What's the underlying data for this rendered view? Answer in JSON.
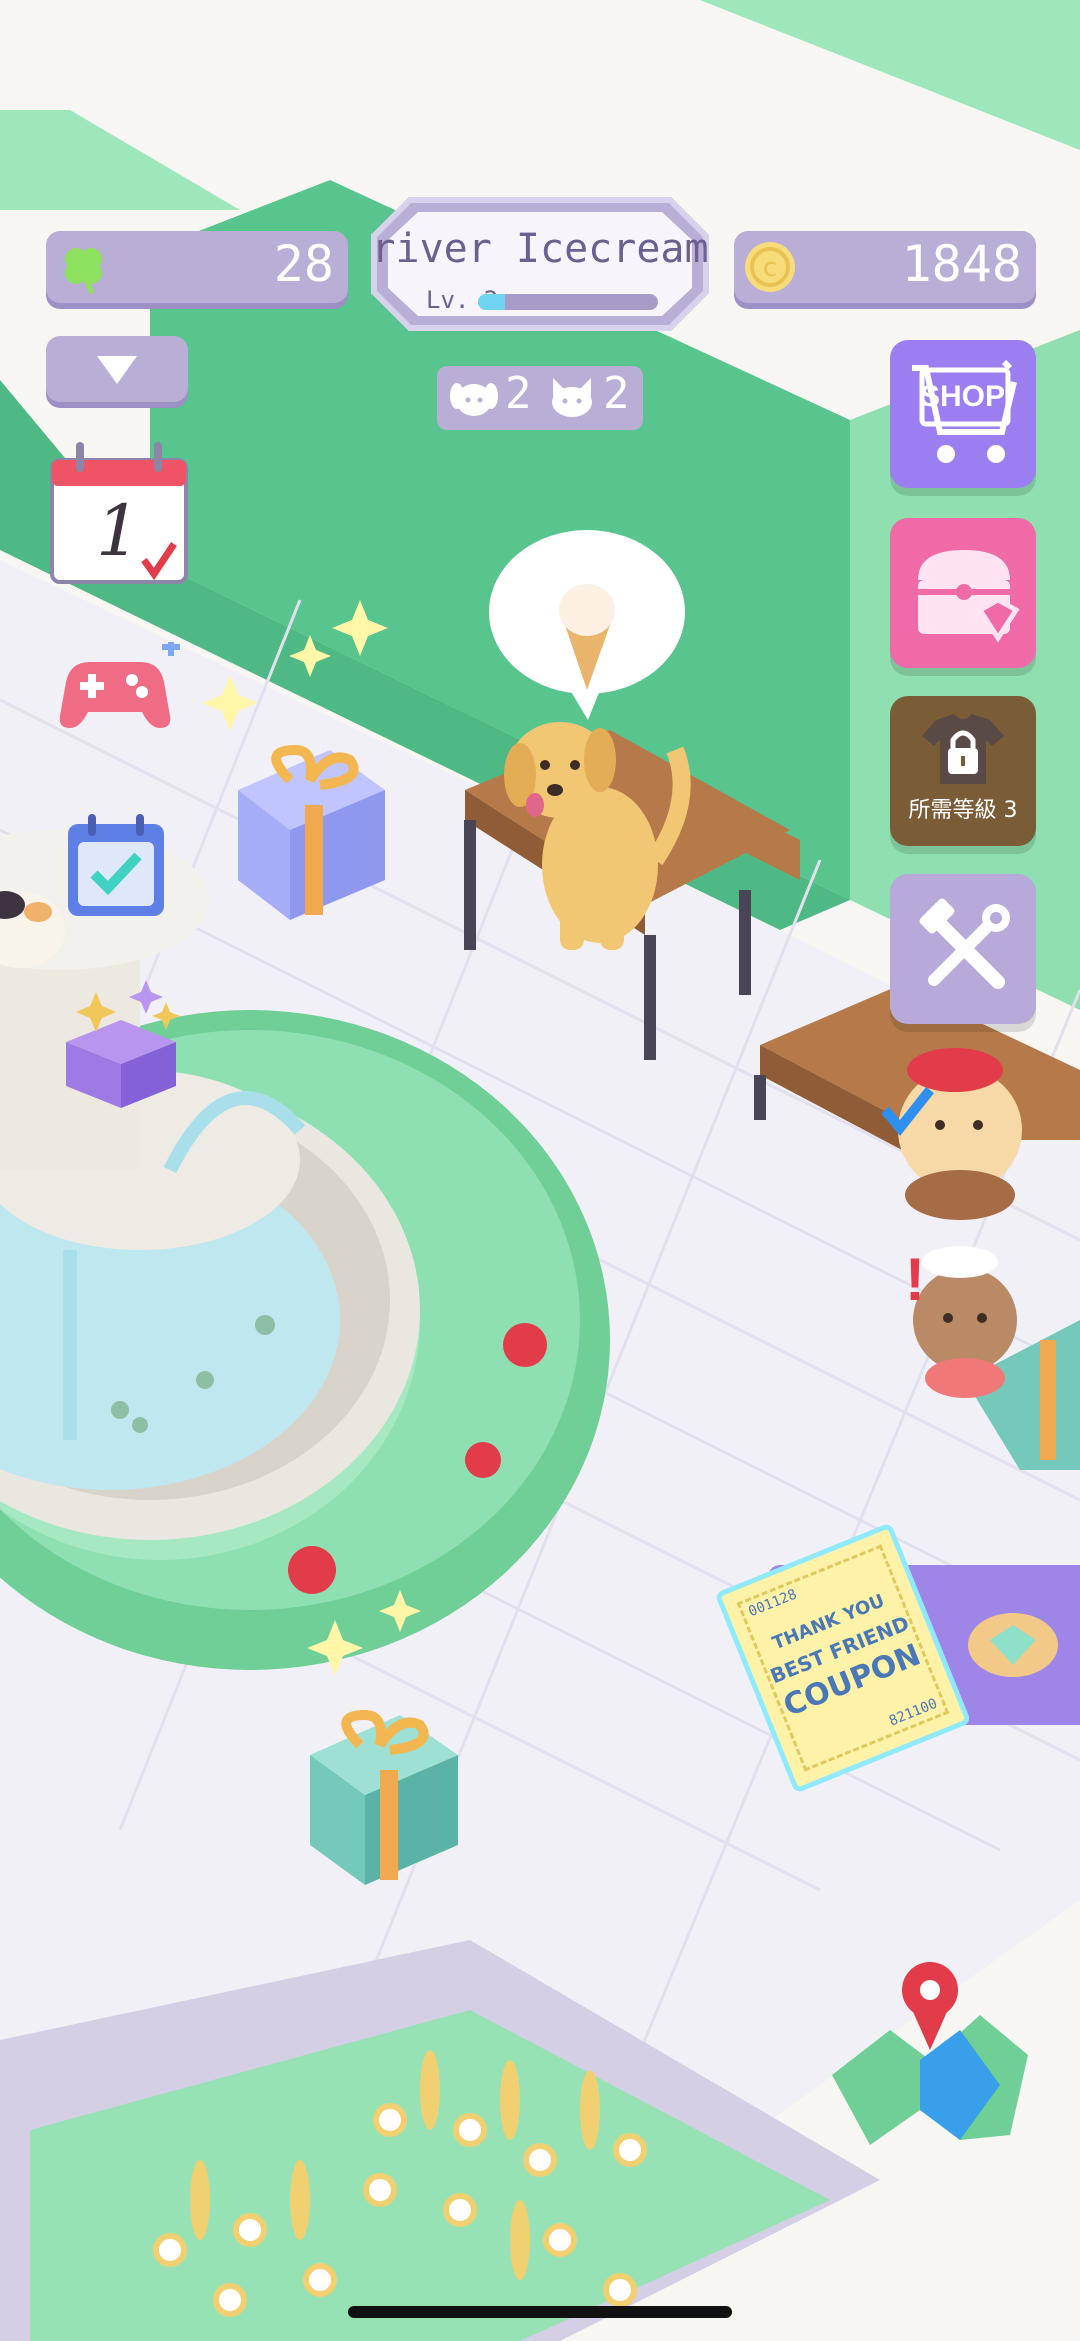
{
  "hud": {
    "clover_count": "28",
    "player_name": "river Icecream",
    "level_label": "Lv. 2",
    "level_progress": 0.15,
    "coin_count": "1848",
    "dog_count": "2",
    "cat_count": "2"
  },
  "side_buttons": {
    "shop_label": "SHOP",
    "locked_label": "所需等級 3"
  },
  "calendar": {
    "day": "1"
  },
  "coupon": {
    "line1": "THANK YOU",
    "line2": "BEST FRIEND",
    "line3": "COUPON",
    "serial_top": "001128",
    "serial_bottom": "821100"
  },
  "colors": {
    "hud_bar": "#b9aed6",
    "grass": "#8fdfb0",
    "hedge": "#58c48e",
    "shop": "#9b7ef0",
    "gift_box": "#f06aa8",
    "locked": "#7a5d37",
    "tools": "#b7a9d9"
  },
  "icons": {
    "clover": "clover-icon",
    "coin": "coin-icon",
    "dropdown": "triangle-down-icon",
    "dog": "dog-face-icon",
    "cat": "cat-face-icon",
    "calendar": "calendar-icon",
    "gamepad": "gamepad-icon",
    "task": "checklist-icon",
    "box": "open-box-icon",
    "map": "map-icon"
  }
}
